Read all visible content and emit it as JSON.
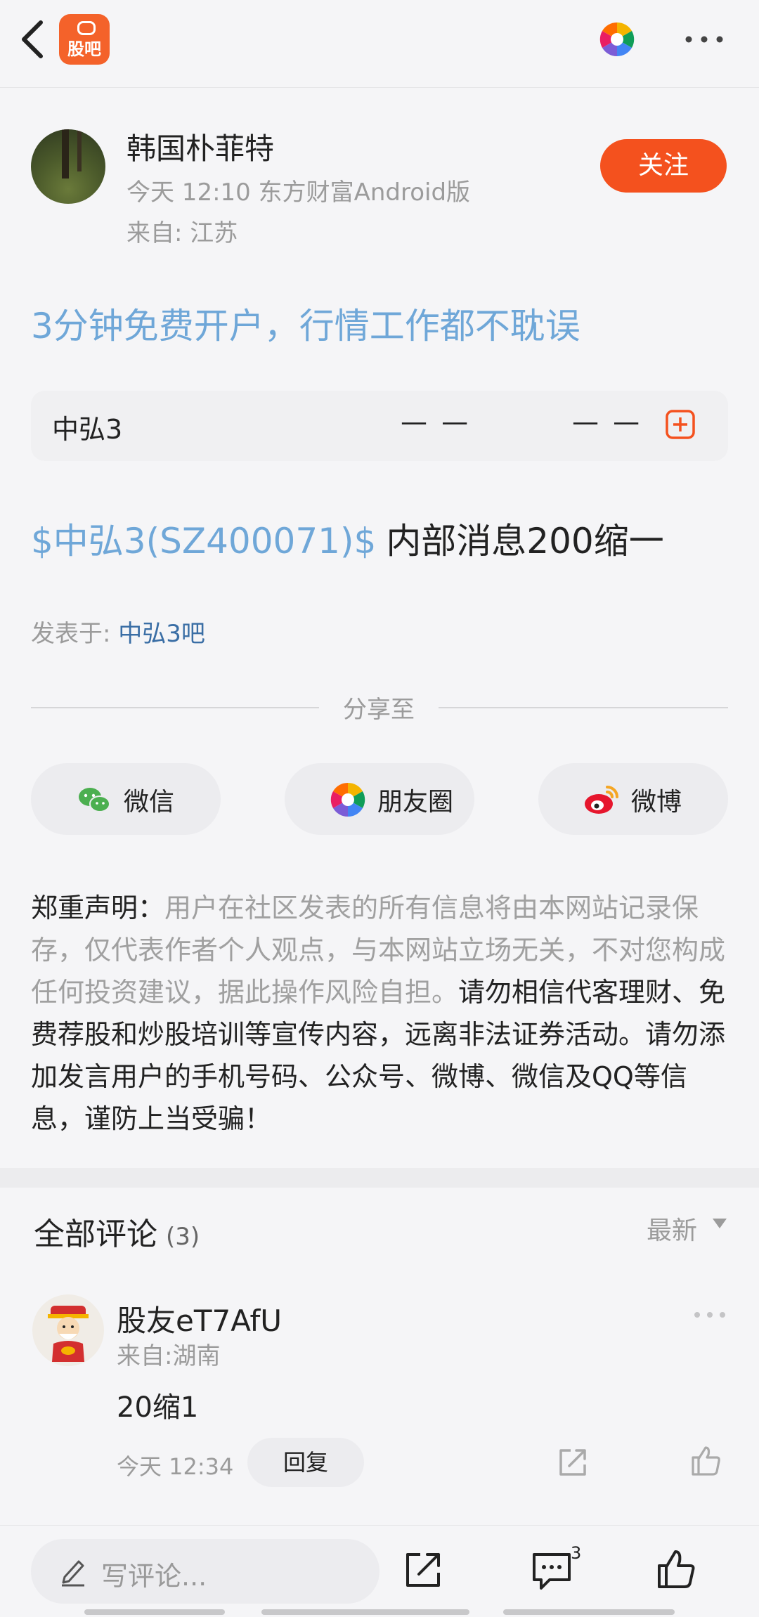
{
  "app": {
    "logo_text": "股吧"
  },
  "author": {
    "name": "韩国朴菲特",
    "meta": "今天 12:10 东方财富Android版",
    "location": "来自: 江苏",
    "follow_label": "关注"
  },
  "promo_text": "3分钟免费开户，行情工作都不耽误",
  "stock_card": {
    "name": "中弘3",
    "price": "— —",
    "change": "— —"
  },
  "post": {
    "stock_link": "$中弘3(SZ400071)$",
    "text": "内部消息200缩一",
    "posted_in_label": "发表于:",
    "forum": "中弘3吧"
  },
  "share": {
    "title": "分享至",
    "buttons": [
      {
        "label": "微信",
        "icon": "wechat-icon"
      },
      {
        "label": "朋友圈",
        "icon": "moments-icon"
      },
      {
        "label": "微博",
        "icon": "weibo-icon"
      }
    ]
  },
  "disclaimer": {
    "label": "郑重声明：",
    "grey": "用户在社区发表的所有信息将由本网站记录保存，仅代表作者个人观点，与本网站立场无关，不对您构成任何投资建议，据此操作风险自担。",
    "black": "请勿相信代客理财、免费荐股和炒股培训等宣传内容，远离非法证券活动。请勿添加发言用户的手机号码、公众号、微博、微信及QQ等信息，谨防上当受骗！"
  },
  "comments": {
    "title": "全部评论",
    "count": "(3)",
    "sort": "最新",
    "items": [
      {
        "user": "股友eT7AfU",
        "location": "来自:湖南",
        "text": "20缩1",
        "time": "今天 12:34",
        "reply_label": "回复"
      }
    ]
  },
  "bottom": {
    "input_placeholder": "写评论...",
    "comment_badge": "3"
  },
  "colors": {
    "accent": "#f4511e",
    "link": "#6fa7d8",
    "forum_link": "#3a6ea5"
  }
}
